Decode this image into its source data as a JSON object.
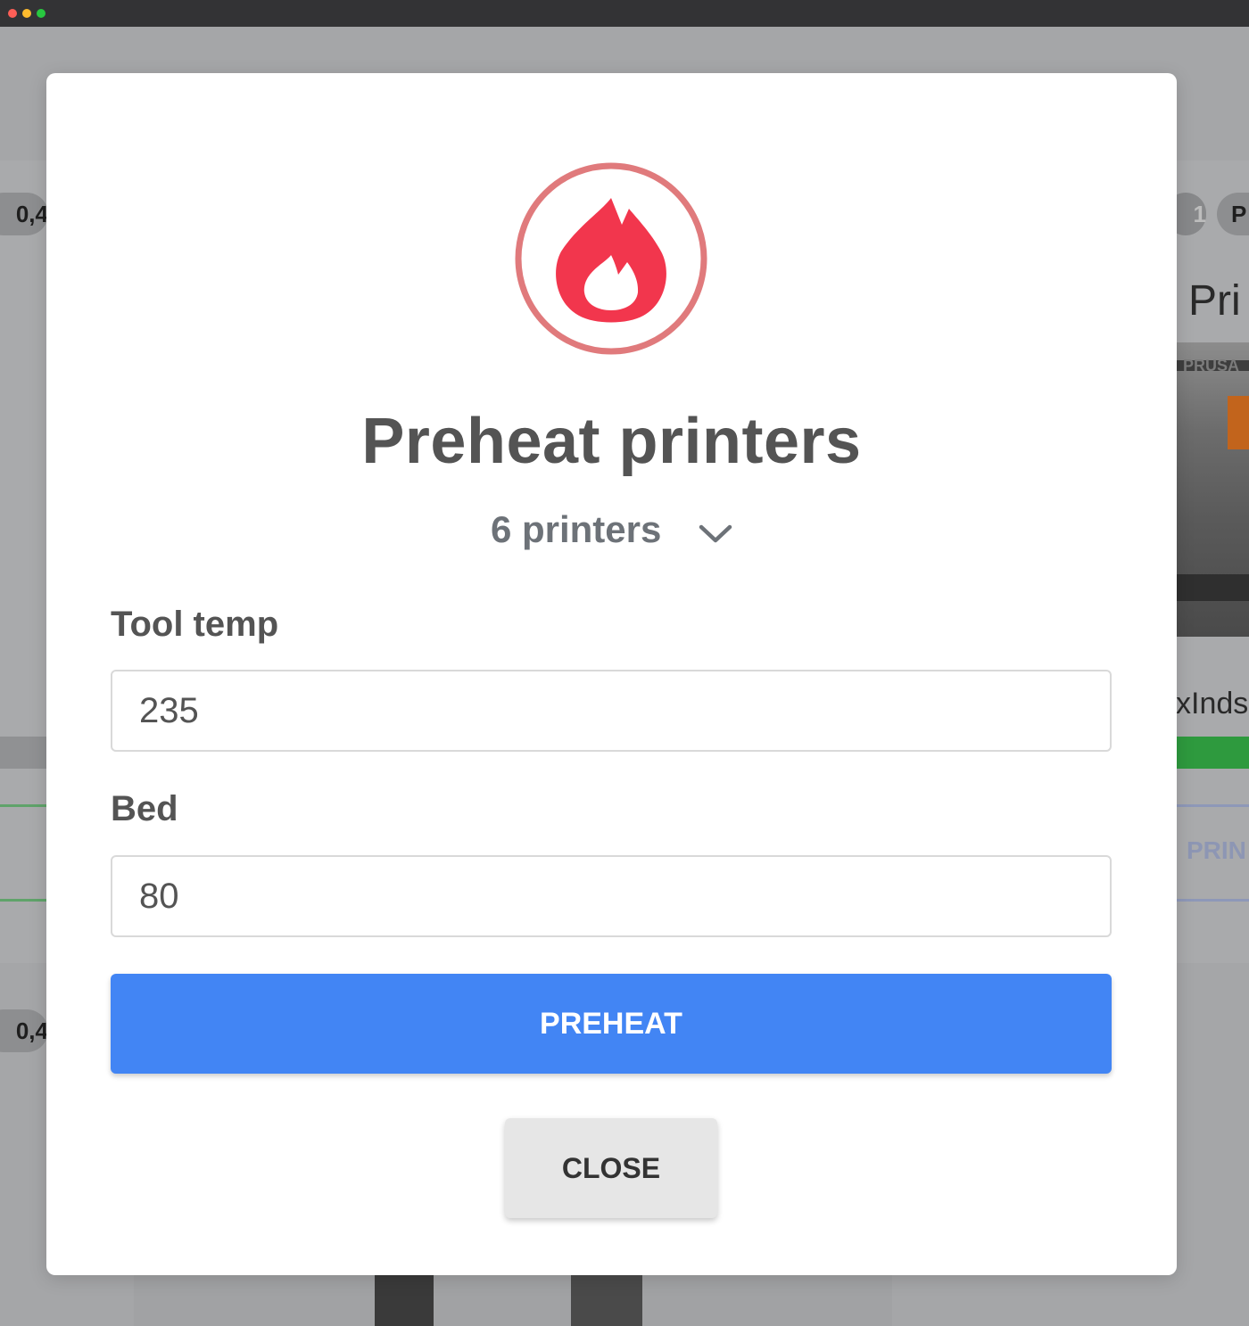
{
  "background": {
    "chip_left_top": "0,4",
    "chip_left_bottom": "0,4",
    "chip_right_number": "1",
    "chip_right_partial": "P",
    "text_partial_title": "Pri",
    "text_partial_name": "xInds",
    "text_partial_action": "PRIN",
    "photo_label": "PRUSA"
  },
  "modal": {
    "icon": "flame-icon",
    "title": "Preheat printers",
    "printers_selector": "6 printers",
    "tool_temp_label": "Tool temp",
    "tool_temp_value": "235",
    "bed_label": "Bed",
    "bed_value": "80",
    "preheat_button": "PREHEAT",
    "close_button": "CLOSE"
  },
  "colors": {
    "accent": "#4285f4",
    "flame": "#f2364d",
    "ring": "#e07a7c"
  }
}
